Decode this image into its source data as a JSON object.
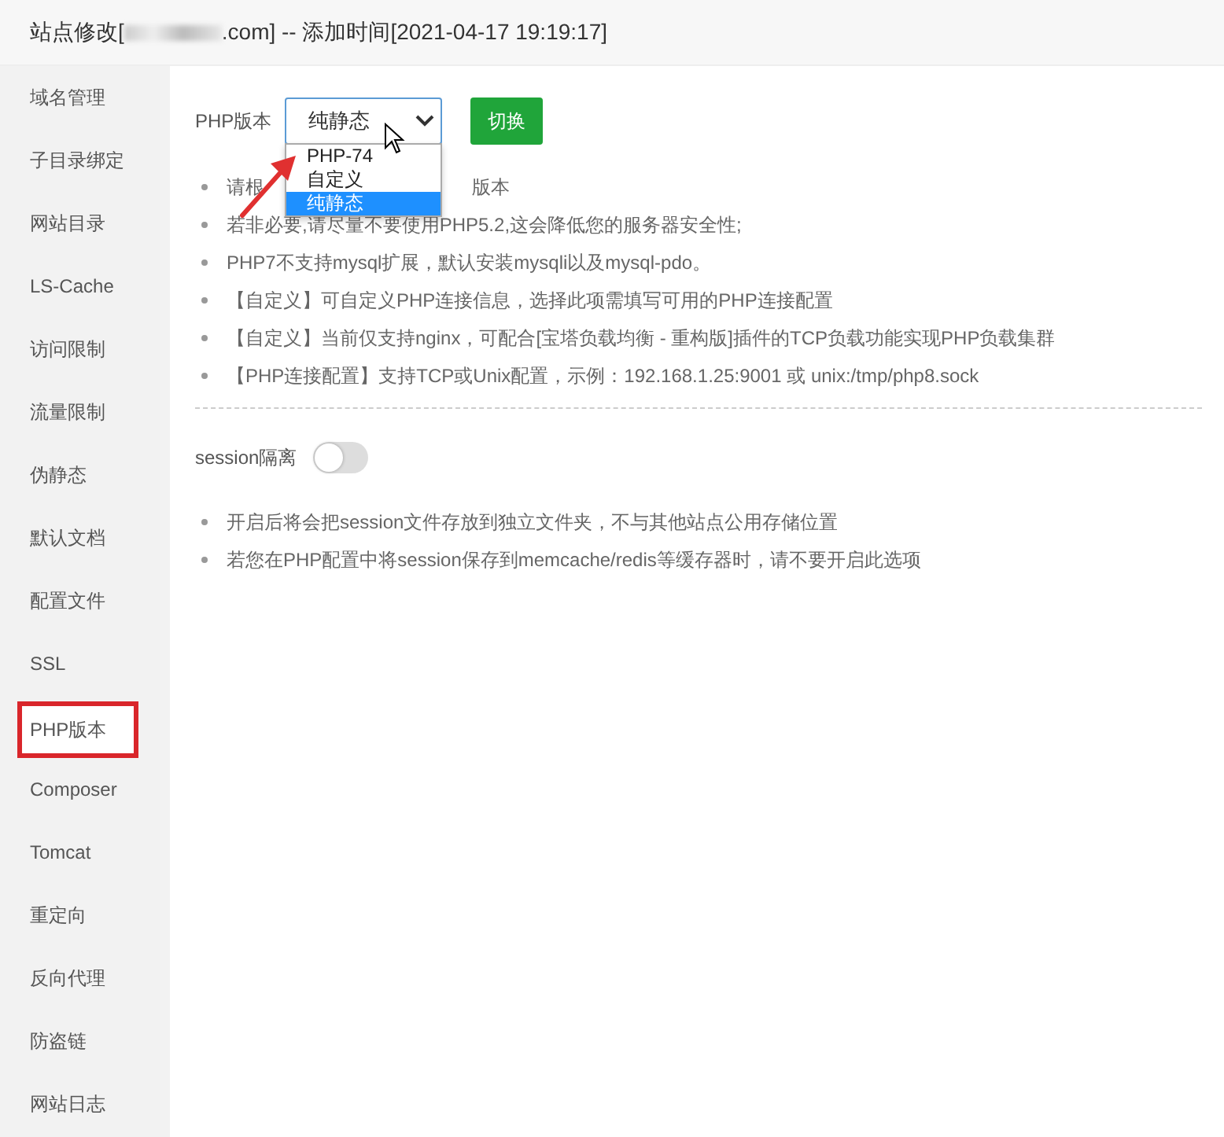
{
  "window": {
    "title_prefix": "站点修改[",
    "title_suffix": ".com] -- 添加时间[2021-04-17 19:19:17]"
  },
  "sidebar": {
    "items": [
      {
        "label": "域名管理",
        "selected": false,
        "annotated": false
      },
      {
        "label": "子目录绑定",
        "selected": false,
        "annotated": false
      },
      {
        "label": "网站目录",
        "selected": false,
        "annotated": false
      },
      {
        "label": "LS-Cache",
        "selected": false,
        "annotated": false
      },
      {
        "label": "访问限制",
        "selected": false,
        "annotated": false
      },
      {
        "label": "流量限制",
        "selected": false,
        "annotated": false
      },
      {
        "label": "伪静态",
        "selected": false,
        "annotated": false
      },
      {
        "label": "默认文档",
        "selected": false,
        "annotated": false
      },
      {
        "label": "配置文件",
        "selected": false,
        "annotated": false
      },
      {
        "label": "SSL",
        "selected": false,
        "annotated": false
      },
      {
        "label": "PHP版本",
        "selected": true,
        "annotated": true
      },
      {
        "label": "Composer",
        "selected": false,
        "annotated": false
      },
      {
        "label": "Tomcat",
        "selected": false,
        "annotated": false
      },
      {
        "label": "重定向",
        "selected": false,
        "annotated": false
      },
      {
        "label": "反向代理",
        "selected": false,
        "annotated": false
      },
      {
        "label": "防盗链",
        "selected": false,
        "annotated": false
      },
      {
        "label": "网站日志",
        "selected": false,
        "annotated": false
      }
    ]
  },
  "php": {
    "label": "PHP版本",
    "select_value": "纯静态",
    "button": "切换",
    "options": [
      {
        "label": "PHP-74",
        "selected": false
      },
      {
        "label": "自定义",
        "selected": false
      },
      {
        "label": "纯静态",
        "selected": true
      }
    ],
    "notes": [
      {
        "fragments": [
          "请根",
          "版本"
        ]
      },
      {
        "fragments": [
          "若非必要,请尽量不要使用PHP5.2,这会降低您的服务器安全性;"
        ]
      },
      {
        "fragments": [
          "PHP7不支持mysql扩展，默认安装mysqli以及mysql-pdo。"
        ]
      },
      {
        "fragments": [
          "【自定义】可自定义PHP连接信息，选择此项需填写可用的PHP连接配置"
        ]
      },
      {
        "fragments": [
          "【自定义】当前仅支持nginx，可配合[宝塔负载均衡 - 重构版]插件的TCP负载功能实现PHP负载集群"
        ]
      },
      {
        "fragments": [
          "【PHP连接配置】支持TCP或Unix配置，示例：192.168.1.25:9001 或 unix:/tmp/php8.sock"
        ]
      }
    ]
  },
  "session": {
    "label": "session隔离",
    "on": false,
    "notes": [
      "开启后将会把session文件存放到独立文件夹，不与其他站点公用存储位置",
      "若您在PHP配置中将session保存到memcache/redis等缓存器时，请不要开启此选项"
    ]
  }
}
